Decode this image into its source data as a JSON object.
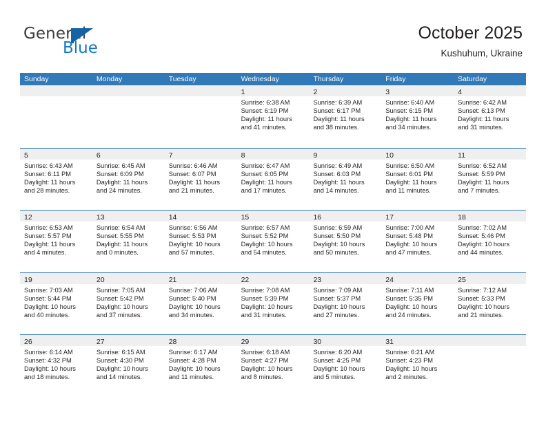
{
  "brand": {
    "name_part1": "General",
    "name_part2": "Blue",
    "flag_icon": "flag-triangle-icon",
    "color_primary": "#1476c4",
    "color_text": "#3c3c3b"
  },
  "header": {
    "title": "October 2025",
    "subtitle": "Kushuhum, Ukraine"
  },
  "theme": {
    "header_blue": "#3179b8",
    "band_gray": "#efeff0",
    "text": "#231f20"
  },
  "weekdays": [
    "Sunday",
    "Monday",
    "Tuesday",
    "Wednesday",
    "Thursday",
    "Friday",
    "Saturday"
  ],
  "weeks": [
    [
      {
        "day": "",
        "lines": []
      },
      {
        "day": "",
        "lines": []
      },
      {
        "day": "",
        "lines": []
      },
      {
        "day": "1",
        "lines": [
          "Sunrise: 6:38 AM",
          "Sunset: 6:19 PM",
          "Daylight: 11 hours",
          "and 41 minutes."
        ]
      },
      {
        "day": "2",
        "lines": [
          "Sunrise: 6:39 AM",
          "Sunset: 6:17 PM",
          "Daylight: 11 hours",
          "and 38 minutes."
        ]
      },
      {
        "day": "3",
        "lines": [
          "Sunrise: 6:40 AM",
          "Sunset: 6:15 PM",
          "Daylight: 11 hours",
          "and 34 minutes."
        ]
      },
      {
        "day": "4",
        "lines": [
          "Sunrise: 6:42 AM",
          "Sunset: 6:13 PM",
          "Daylight: 11 hours",
          "and 31 minutes."
        ]
      }
    ],
    [
      {
        "day": "5",
        "lines": [
          "Sunrise: 6:43 AM",
          "Sunset: 6:11 PM",
          "Daylight: 11 hours",
          "and 28 minutes."
        ]
      },
      {
        "day": "6",
        "lines": [
          "Sunrise: 6:45 AM",
          "Sunset: 6:09 PM",
          "Daylight: 11 hours",
          "and 24 minutes."
        ]
      },
      {
        "day": "7",
        "lines": [
          "Sunrise: 6:46 AM",
          "Sunset: 6:07 PM",
          "Daylight: 11 hours",
          "and 21 minutes."
        ]
      },
      {
        "day": "8",
        "lines": [
          "Sunrise: 6:47 AM",
          "Sunset: 6:05 PM",
          "Daylight: 11 hours",
          "and 17 minutes."
        ]
      },
      {
        "day": "9",
        "lines": [
          "Sunrise: 6:49 AM",
          "Sunset: 6:03 PM",
          "Daylight: 11 hours",
          "and 14 minutes."
        ]
      },
      {
        "day": "10",
        "lines": [
          "Sunrise: 6:50 AM",
          "Sunset: 6:01 PM",
          "Daylight: 11 hours",
          "and 11 minutes."
        ]
      },
      {
        "day": "11",
        "lines": [
          "Sunrise: 6:52 AM",
          "Sunset: 5:59 PM",
          "Daylight: 11 hours",
          "and 7 minutes."
        ]
      }
    ],
    [
      {
        "day": "12",
        "lines": [
          "Sunrise: 6:53 AM",
          "Sunset: 5:57 PM",
          "Daylight: 11 hours",
          "and 4 minutes."
        ]
      },
      {
        "day": "13",
        "lines": [
          "Sunrise: 6:54 AM",
          "Sunset: 5:55 PM",
          "Daylight: 11 hours",
          "and 0 minutes."
        ]
      },
      {
        "day": "14",
        "lines": [
          "Sunrise: 6:56 AM",
          "Sunset: 5:53 PM",
          "Daylight: 10 hours",
          "and 57 minutes."
        ]
      },
      {
        "day": "15",
        "lines": [
          "Sunrise: 6:57 AM",
          "Sunset: 5:52 PM",
          "Daylight: 10 hours",
          "and 54 minutes."
        ]
      },
      {
        "day": "16",
        "lines": [
          "Sunrise: 6:59 AM",
          "Sunset: 5:50 PM",
          "Daylight: 10 hours",
          "and 50 minutes."
        ]
      },
      {
        "day": "17",
        "lines": [
          "Sunrise: 7:00 AM",
          "Sunset: 5:48 PM",
          "Daylight: 10 hours",
          "and 47 minutes."
        ]
      },
      {
        "day": "18",
        "lines": [
          "Sunrise: 7:02 AM",
          "Sunset: 5:46 PM",
          "Daylight: 10 hours",
          "and 44 minutes."
        ]
      }
    ],
    [
      {
        "day": "19",
        "lines": [
          "Sunrise: 7:03 AM",
          "Sunset: 5:44 PM",
          "Daylight: 10 hours",
          "and 40 minutes."
        ]
      },
      {
        "day": "20",
        "lines": [
          "Sunrise: 7:05 AM",
          "Sunset: 5:42 PM",
          "Daylight: 10 hours",
          "and 37 minutes."
        ]
      },
      {
        "day": "21",
        "lines": [
          "Sunrise: 7:06 AM",
          "Sunset: 5:40 PM",
          "Daylight: 10 hours",
          "and 34 minutes."
        ]
      },
      {
        "day": "22",
        "lines": [
          "Sunrise: 7:08 AM",
          "Sunset: 5:39 PM",
          "Daylight: 10 hours",
          "and 31 minutes."
        ]
      },
      {
        "day": "23",
        "lines": [
          "Sunrise: 7:09 AM",
          "Sunset: 5:37 PM",
          "Daylight: 10 hours",
          "and 27 minutes."
        ]
      },
      {
        "day": "24",
        "lines": [
          "Sunrise: 7:11 AM",
          "Sunset: 5:35 PM",
          "Daylight: 10 hours",
          "and 24 minutes."
        ]
      },
      {
        "day": "25",
        "lines": [
          "Sunrise: 7:12 AM",
          "Sunset: 5:33 PM",
          "Daylight: 10 hours",
          "and 21 minutes."
        ]
      }
    ],
    [
      {
        "day": "26",
        "lines": [
          "Sunrise: 6:14 AM",
          "Sunset: 4:32 PM",
          "Daylight: 10 hours",
          "and 18 minutes."
        ]
      },
      {
        "day": "27",
        "lines": [
          "Sunrise: 6:15 AM",
          "Sunset: 4:30 PM",
          "Daylight: 10 hours",
          "and 14 minutes."
        ]
      },
      {
        "day": "28",
        "lines": [
          "Sunrise: 6:17 AM",
          "Sunset: 4:28 PM",
          "Daylight: 10 hours",
          "and 11 minutes."
        ]
      },
      {
        "day": "29",
        "lines": [
          "Sunrise: 6:18 AM",
          "Sunset: 4:27 PM",
          "Daylight: 10 hours",
          "and 8 minutes."
        ]
      },
      {
        "day": "30",
        "lines": [
          "Sunrise: 6:20 AM",
          "Sunset: 4:25 PM",
          "Daylight: 10 hours",
          "and 5 minutes."
        ]
      },
      {
        "day": "31",
        "lines": [
          "Sunrise: 6:21 AM",
          "Sunset: 4:23 PM",
          "Daylight: 10 hours",
          "and 2 minutes."
        ]
      },
      {
        "day": "",
        "lines": []
      }
    ]
  ]
}
